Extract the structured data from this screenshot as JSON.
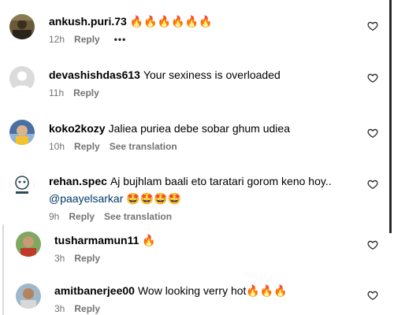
{
  "comments": [
    {
      "username": "ankush.puri.73",
      "text": "",
      "emojis": "🔥🔥🔥🔥🔥🔥",
      "time": "12h",
      "reply_label": "Reply",
      "more_label": "•••"
    },
    {
      "username": "devashishdas613",
      "text": "Your sexiness is overloaded",
      "time": "11h",
      "reply_label": "Reply"
    },
    {
      "username": "koko2kozy",
      "text": "Jaliea puriea debe sobar ghum udiea",
      "time": "10h",
      "reply_label": "Reply",
      "translate_label": "See translation"
    },
    {
      "username": "rehan.spec",
      "text": "Aj bujhlam baali eto taratari gorom keno hoy..",
      "mention": "@paayelsarkar",
      "emojis": "🤩🤩🤩🤩",
      "time": "9h",
      "reply_label": "Reply",
      "translate_label": "See translation"
    }
  ],
  "replies": [
    {
      "username": "tusharmamun11",
      "text": "",
      "emojis": "🔥",
      "time": "3h",
      "reply_label": "Reply"
    },
    {
      "username": "amitbanerjee00",
      "text": "Wow looking verry hot",
      "emojis": "🔥🔥🔥",
      "time": "3h",
      "reply_label": "Reply"
    }
  ],
  "colors": {
    "username": "#000000",
    "meta": "#737373",
    "mention": "#00376b",
    "scroll_indicator": "#2b2b2b",
    "reply_line": "#d9d9d9"
  },
  "icons": {
    "like": "heart-outline-icon",
    "more": "more-options-icon"
  }
}
